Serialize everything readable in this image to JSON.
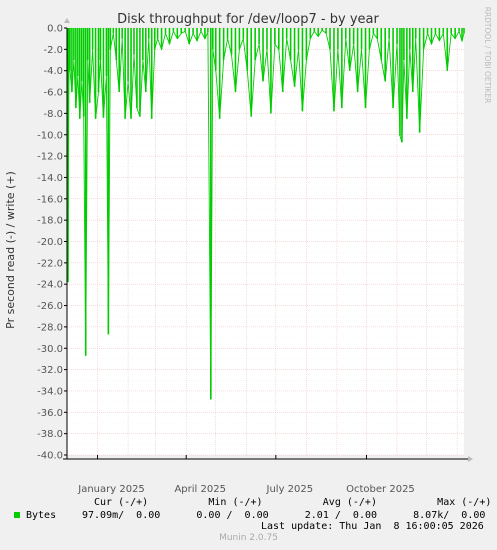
{
  "chart_data": {
    "type": "area",
    "title": "Disk throughput for /dev/loop7 - by year",
    "ylabel": "Pr second read (-) / write (+)",
    "side_label": "RRDTOOL / TOBI OETIKER",
    "ylim": [
      -40.0,
      0.0
    ],
    "yticks": [
      0.0,
      -2.0,
      -4.0,
      -6.0,
      -8.0,
      -10.0,
      -12.0,
      -14.0,
      -16.0,
      -18.0,
      -20.0,
      -22.0,
      -24.0,
      -26.0,
      -28.0,
      -30.0,
      -32.0,
      -34.0,
      -36.0,
      -38.0,
      -40.0
    ],
    "ytick_labels": [
      "0.0",
      "-2.0",
      "-4.0",
      "-6.0",
      "-8.0",
      "-10.0",
      "-12.0",
      "-14.0",
      "-16.0",
      "-18.0",
      "-20.0",
      "-22.0",
      "-24.0",
      "-26.0",
      "-28.0",
      "-30.0",
      "-32.0",
      "-34.0",
      "-36.0",
      "-38.0",
      "-40.0"
    ],
    "xlim": [
      "2024-12-01",
      "2026-01-08"
    ],
    "xticks": [
      {
        "date": "2025-01-01",
        "label": "January 2025"
      },
      {
        "date": "2025-04-01",
        "label": "April 2025"
      },
      {
        "date": "2025-07-01",
        "label": "July 2025"
      },
      {
        "date": "2025-10-01",
        "label": "October 2025"
      }
    ],
    "grid": true,
    "series": [
      {
        "name": "Bytes",
        "color": "#00cc00",
        "points": [
          [
            "2024-12-01",
            0
          ],
          [
            "2024-12-02",
            -23.8
          ],
          [
            "2024-12-03",
            -2
          ],
          [
            "2024-12-04",
            -4
          ],
          [
            "2024-12-06",
            -6
          ],
          [
            "2024-12-08",
            -3
          ],
          [
            "2024-12-10",
            -7.5
          ],
          [
            "2024-12-12",
            -4.5
          ],
          [
            "2024-12-14",
            -8.5
          ],
          [
            "2024-12-16",
            -5
          ],
          [
            "2024-12-18",
            -8.3
          ],
          [
            "2024-12-20",
            -30.7
          ],
          [
            "2024-12-22",
            -3
          ],
          [
            "2024-12-24",
            -7
          ],
          [
            "2024-12-27",
            -2
          ],
          [
            "2024-12-30",
            -8.5
          ],
          [
            "2025-01-02",
            -6
          ],
          [
            "2025-01-04",
            -3
          ],
          [
            "2025-01-07",
            -8.4
          ],
          [
            "2025-01-10",
            -4.5
          ],
          [
            "2025-01-12",
            -28.7
          ],
          [
            "2025-01-14",
            -2
          ],
          [
            "2025-01-17",
            -0.5
          ],
          [
            "2025-01-20",
            -3
          ],
          [
            "2025-01-23",
            -6
          ],
          [
            "2025-01-26",
            -1
          ],
          [
            "2025-01-29",
            -8.5
          ],
          [
            "2025-02-01",
            -5
          ],
          [
            "2025-02-04",
            -8.5
          ],
          [
            "2025-02-07",
            -2.5
          ],
          [
            "2025-02-10",
            -7.5
          ],
          [
            "2025-02-13",
            -8.3
          ],
          [
            "2025-02-16",
            -3
          ],
          [
            "2025-02-19",
            -6
          ],
          [
            "2025-02-22",
            -1
          ],
          [
            "2025-02-25",
            -8.5
          ],
          [
            "2025-02-28",
            -2
          ],
          [
            "2025-03-03",
            -1
          ],
          [
            "2025-03-07",
            -2
          ],
          [
            "2025-03-11",
            -0.5
          ],
          [
            "2025-03-15",
            -1.5
          ],
          [
            "2025-03-19",
            -0.3
          ],
          [
            "2025-03-23",
            -1
          ],
          [
            "2025-03-27",
            -0.5
          ],
          [
            "2025-03-31",
            -0.3
          ],
          [
            "2025-04-04",
            -1.5
          ],
          [
            "2025-04-08",
            -0.5
          ],
          [
            "2025-04-12",
            -1.2
          ],
          [
            "2025-04-16",
            -0.3
          ],
          [
            "2025-04-20",
            -1
          ],
          [
            "2025-04-23",
            -0.4
          ],
          [
            "2025-04-26",
            -34.8
          ],
          [
            "2025-04-28",
            -2
          ],
          [
            "2025-05-01",
            -4
          ],
          [
            "2025-05-05",
            -8.5
          ],
          [
            "2025-05-09",
            -3
          ],
          [
            "2025-05-13",
            -1
          ],
          [
            "2025-05-17",
            -2.5
          ],
          [
            "2025-05-21",
            -6
          ],
          [
            "2025-05-25",
            -2
          ],
          [
            "2025-05-29",
            -1
          ],
          [
            "2025-06-02",
            -4
          ],
          [
            "2025-06-06",
            -8.3
          ],
          [
            "2025-06-10",
            -3
          ],
          [
            "2025-06-14",
            -1.5
          ],
          [
            "2025-06-18",
            -5
          ],
          [
            "2025-06-22",
            -2
          ],
          [
            "2025-06-26",
            -8
          ],
          [
            "2025-06-30",
            -1.5
          ],
          [
            "2025-07-04",
            -2
          ],
          [
            "2025-07-08",
            -6
          ],
          [
            "2025-07-12",
            -1
          ],
          [
            "2025-07-16",
            -3
          ],
          [
            "2025-07-20",
            -5.5
          ],
          [
            "2025-07-24",
            -2
          ],
          [
            "2025-07-28",
            -7.8
          ],
          [
            "2025-08-01",
            -3
          ],
          [
            "2025-08-05",
            -1
          ],
          [
            "2025-08-09",
            -0.3
          ],
          [
            "2025-08-13",
            -0.8
          ],
          [
            "2025-08-17",
            -0.2
          ],
          [
            "2025-08-21",
            -0.5
          ],
          [
            "2025-08-25",
            -2
          ],
          [
            "2025-08-29",
            -7.8
          ],
          [
            "2025-09-02",
            -2
          ],
          [
            "2025-09-06",
            -7.5
          ],
          [
            "2025-09-10",
            -1
          ],
          [
            "2025-09-14",
            -4
          ],
          [
            "2025-09-18",
            -1.5
          ],
          [
            "2025-09-22",
            -6
          ],
          [
            "2025-09-26",
            -2
          ],
          [
            "2025-09-30",
            -7.5
          ],
          [
            "2025-10-04",
            -2
          ],
          [
            "2025-10-08",
            -0.5
          ],
          [
            "2025-10-12",
            -1
          ],
          [
            "2025-10-16",
            -3
          ],
          [
            "2025-10-20",
            -5
          ],
          [
            "2025-10-24",
            -1
          ],
          [
            "2025-10-28",
            -7.5
          ],
          [
            "2025-11-01",
            -1.5
          ],
          [
            "2025-11-04",
            -10.1
          ],
          [
            "2025-11-06",
            -10.7
          ],
          [
            "2025-11-08",
            -3
          ],
          [
            "2025-11-11",
            -8.5
          ],
          [
            "2025-11-14",
            -2
          ],
          [
            "2025-11-17",
            -6
          ],
          [
            "2025-11-20",
            -1
          ],
          [
            "2025-11-24",
            -9.8
          ],
          [
            "2025-11-28",
            -2
          ],
          [
            "2025-12-02",
            -0.5
          ],
          [
            "2025-12-06",
            -1.5
          ],
          [
            "2025-12-10",
            -0.5
          ],
          [
            "2025-12-14",
            -1.2
          ],
          [
            "2025-12-18",
            -0.5
          ],
          [
            "2025-12-22",
            -4
          ],
          [
            "2025-12-26",
            -0.5
          ],
          [
            "2025-12-30",
            -1
          ],
          [
            "2026-01-03",
            -0.3
          ],
          [
            "2026-01-06",
            -1.2
          ],
          [
            "2026-01-08",
            -0.5
          ]
        ]
      }
    ]
  },
  "legend": {
    "header": "Cur (-/+)          Min (-/+)          Avg (-/+)          Max (-/+)",
    "row_label": "Bytes",
    "row_values": "97.09m/  0.00      0.00 /  0.00      2.01 /  0.00      8.07k/  0.00",
    "last_update": "Last update: Thu Jan  8 16:00:05 2026"
  },
  "footer": "Munin 2.0.75"
}
